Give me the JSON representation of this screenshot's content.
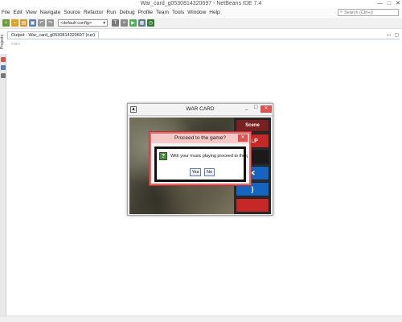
{
  "window": {
    "title": "War_card_g0530814320697 - NetBeans IDE 7.4",
    "controls": [
      "—",
      "□",
      "✕"
    ]
  },
  "menu": [
    "File",
    "Edit",
    "View",
    "Navigate",
    "Source",
    "Refactor",
    "Run",
    "Debug",
    "Profile",
    "Team",
    "Tools",
    "Window",
    "Help"
  ],
  "search": {
    "placeholder": "Search (Ctrl+I)"
  },
  "toolbar": {
    "config_value": "<default config>"
  },
  "sidebar": {
    "projects_tab": "Projects"
  },
  "output": {
    "tab_label": "Output - War_card_g0530814320697 (run)",
    "first_line": "run:"
  },
  "war_card": {
    "title": "WAR CARD",
    "min": "_",
    "max": "□",
    "close": "✕",
    "buttons": [
      {
        "label": "Scene",
        "color": "#7a2020"
      },
      {
        "label": "ELP",
        "color": "#c62828"
      },
      {
        "label": "",
        "color": "#1a1a1a"
      },
      {
        "label": "✕",
        "color": "#1565c0"
      },
      {
        "label": ")",
        "color": "#1565c0"
      },
      {
        "label": "",
        "color": "#c62828"
      }
    ]
  },
  "dialog": {
    "title": "Proceed to the game?",
    "close": "✕",
    "icon": "?",
    "message": "With your music playing proceed to the game",
    "yes_label": "Yes",
    "no_label": "No"
  },
  "colors": {
    "dialog_border": "#e06a6a",
    "dialog_title_bg": "#f6c9c9",
    "question_icon": "#4a8a3c"
  }
}
